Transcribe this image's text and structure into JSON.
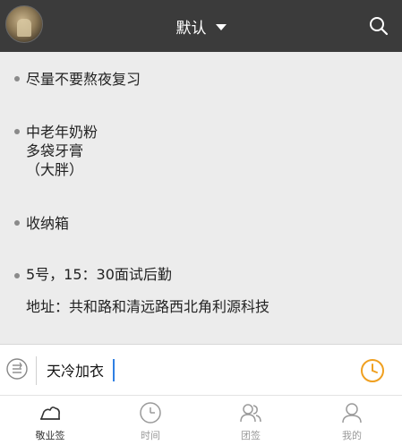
{
  "header": {
    "title": "默认"
  },
  "notes": [
    {
      "lines": "尽量不要熬夜复习"
    },
    {
      "lines": "中老年奶粉\n多袋牙膏\n（大胖）"
    },
    {
      "lines": "收纳箱"
    },
    {
      "lines": "5号，15：30面试后勤\n\n地址：共和路和清远路西北角利源科技"
    }
  ],
  "composer": {
    "value": "天冷加衣"
  },
  "tabs": [
    {
      "label": "敬业签"
    },
    {
      "label": "时间"
    },
    {
      "label": "团签"
    },
    {
      "label": "我的"
    }
  ],
  "colors": {
    "header_bg": "#3b3b3b",
    "list_bg": "#ececec",
    "accent_clock": "#f0a020",
    "cursor": "#2f7fe3"
  }
}
